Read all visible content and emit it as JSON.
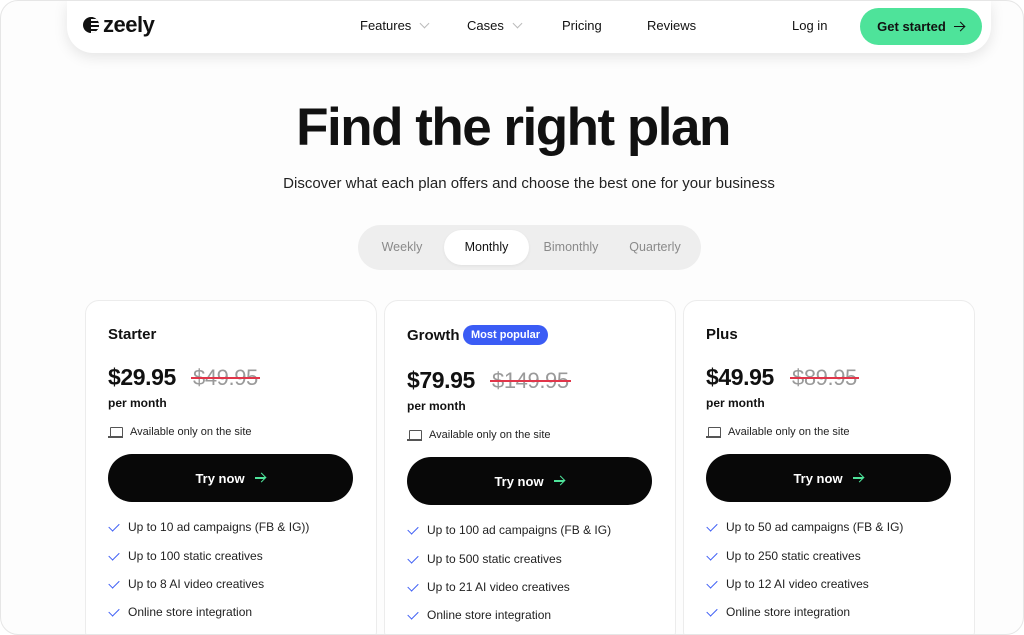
{
  "brand": {
    "name": "zeely"
  },
  "nav": {
    "items": [
      {
        "label": "Features",
        "has_dropdown": true
      },
      {
        "label": "Cases",
        "has_dropdown": true
      },
      {
        "label": "Pricing",
        "has_dropdown": false
      },
      {
        "label": "Reviews",
        "has_dropdown": false
      }
    ],
    "login_label": "Log in",
    "cta_label": "Get started"
  },
  "hero": {
    "title": "Find the right plan",
    "subtitle": "Discover what each plan offers and choose the best one for your business"
  },
  "billing_toggle": {
    "options": [
      "Weekly",
      "Monthly",
      "Bimonthly",
      "Quarterly"
    ],
    "selected": "Monthly"
  },
  "plans": [
    {
      "name": "Starter",
      "badge": "",
      "price": "$29.95",
      "old_price": "$49.95",
      "period": "per month",
      "availability": "Available only on the site",
      "button_label": "Try now",
      "features": [
        "Up to 10 ad campaigns (FB & IG))",
        "Up to 100 static creatives",
        "Up to 8 AI video creatives",
        "Online store integration"
      ]
    },
    {
      "name": "Growth",
      "badge": "Most popular",
      "price": "$79.95",
      "old_price": "$149.95",
      "period": "per month",
      "availability": "Available only on the site",
      "button_label": "Try now",
      "features": [
        "Up to 100 ad campaigns (FB & IG)",
        "Up to 500 static creatives",
        "Up to 21 AI video creatives",
        "Online store integration"
      ]
    },
    {
      "name": "Plus",
      "badge": "",
      "price": "$49.95",
      "old_price": "$89.95",
      "period": "per month",
      "availability": "Available only on the site",
      "button_label": "Try now",
      "features": [
        "Up to 50 ad campaigns (FB & IG)",
        "Up to 250 static creatives",
        "Up to 12 AI video creatives",
        "Online store integration"
      ]
    }
  ],
  "colors": {
    "accent_green": "#4ee39a",
    "badge_blue": "#3b5cf5",
    "strike_red": "#e1364a",
    "button_black": "#080808"
  }
}
